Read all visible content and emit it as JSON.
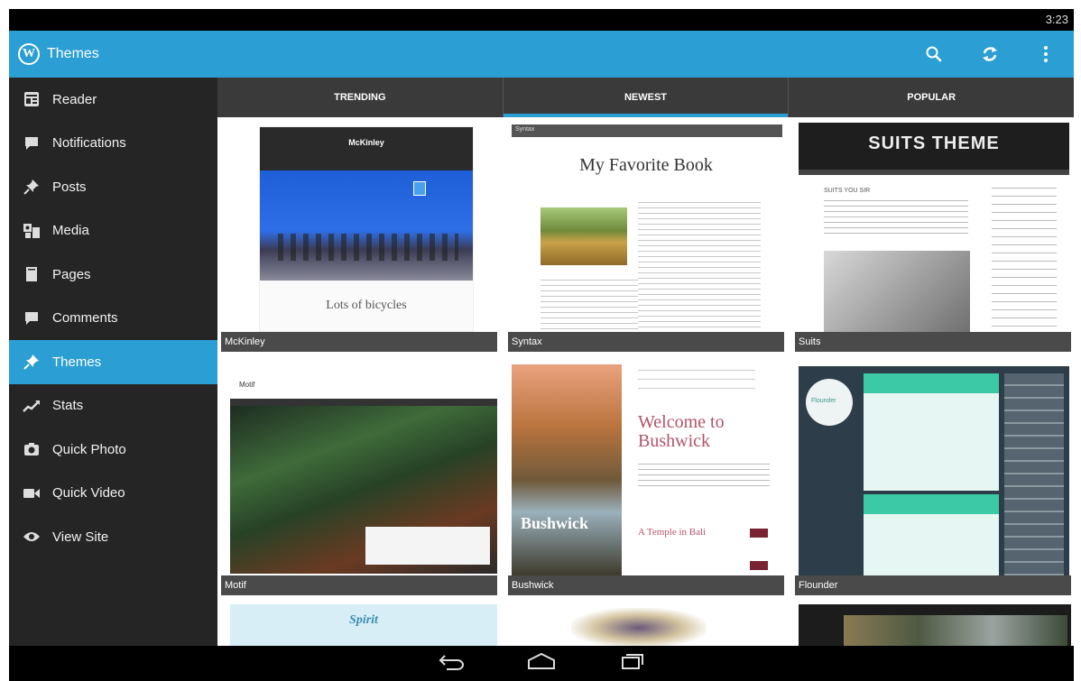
{
  "status_bar": {
    "time": "3:23"
  },
  "action_bar": {
    "logo": "W",
    "title": "Themes",
    "icons": [
      "search-icon",
      "refresh-icon",
      "overflow-menu-icon"
    ]
  },
  "drawer": {
    "items": [
      {
        "label": "Reader",
        "icon": "reader-icon"
      },
      {
        "label": "Notifications",
        "icon": "notifications-icon"
      },
      {
        "label": "Posts",
        "icon": "pin-icon"
      },
      {
        "label": "Media",
        "icon": "media-icon"
      },
      {
        "label": "Pages",
        "icon": "pages-icon"
      },
      {
        "label": "Comments",
        "icon": "comments-icon"
      },
      {
        "label": "Themes",
        "icon": "themes-icon",
        "active": true
      },
      {
        "label": "Stats",
        "icon": "stats-icon"
      },
      {
        "label": "Quick Photo",
        "icon": "camera-icon"
      },
      {
        "label": "Quick Video",
        "icon": "video-icon"
      },
      {
        "label": "View Site",
        "icon": "eye-icon"
      }
    ]
  },
  "tabs": [
    {
      "label": "TRENDING"
    },
    {
      "label": "NEWEST",
      "active": true
    },
    {
      "label": "POPULAR"
    }
  ],
  "themes": [
    {
      "name": "McKinley",
      "preview_title": "McKinley",
      "preview_heading": "Lots of bicycles"
    },
    {
      "name": "Syntax",
      "preview_title": "Syntax",
      "preview_heading": "My Favorite Book"
    },
    {
      "name": "Suits",
      "preview_title": "SUITS THEME",
      "preview_heading": "SUITS YOU SIR"
    },
    {
      "name": "Motif",
      "preview_title": "Motif",
      "preview_heading": ""
    },
    {
      "name": "Bushwick",
      "preview_title": "Bushwick",
      "preview_heading": "Welcome to Bushwick",
      "preview_sub": "A Temple in Bali"
    },
    {
      "name": "Flounder",
      "preview_title": "Flounder",
      "preview_heading": ""
    },
    {
      "name": "",
      "preview_title": "Spirit",
      "preview_heading": ""
    },
    {
      "name": "",
      "preview_title": "",
      "preview_heading": ""
    },
    {
      "name": "",
      "preview_title": "",
      "preview_heading": ""
    }
  ],
  "colors": {
    "accent": "#2b9ed3",
    "drawer_bg": "#252525",
    "tab_bg": "#3a3a3a",
    "caption_bg": "#4a4a4a"
  },
  "system_nav": {
    "icons": [
      "back-icon",
      "home-icon",
      "recent-apps-icon"
    ]
  }
}
